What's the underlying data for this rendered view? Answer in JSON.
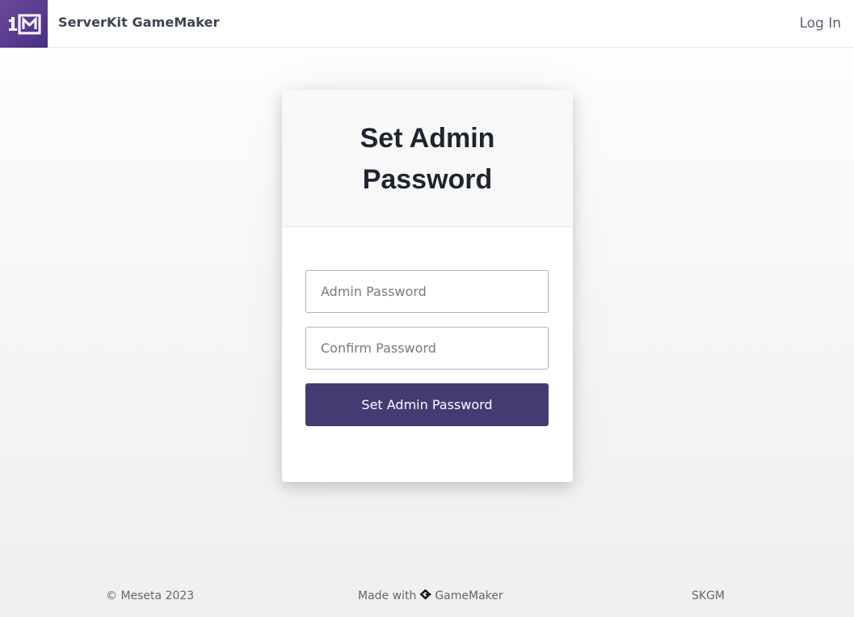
{
  "header": {
    "logo_icon": "meseta-1m-logo-icon",
    "brand": "ServerKit GameMaker",
    "login_label": "Log In"
  },
  "card": {
    "title": "Set Admin Password",
    "password_placeholder": "Admin Password",
    "password_value": "",
    "confirm_placeholder": "Confirm Password",
    "confirm_value": "",
    "submit_label": "Set Admin Password"
  },
  "footer": {
    "copyright": "© Meseta 2023",
    "made_with_prefix": "Made with",
    "gm_icon": "gamemaker-logo-icon",
    "made_with_brand": "GameMaker",
    "right_label": "SKGM"
  },
  "colors": {
    "logo_bg": "#4a2f86",
    "button_bg": "#433c73",
    "text_dark": "#1e2430"
  }
}
